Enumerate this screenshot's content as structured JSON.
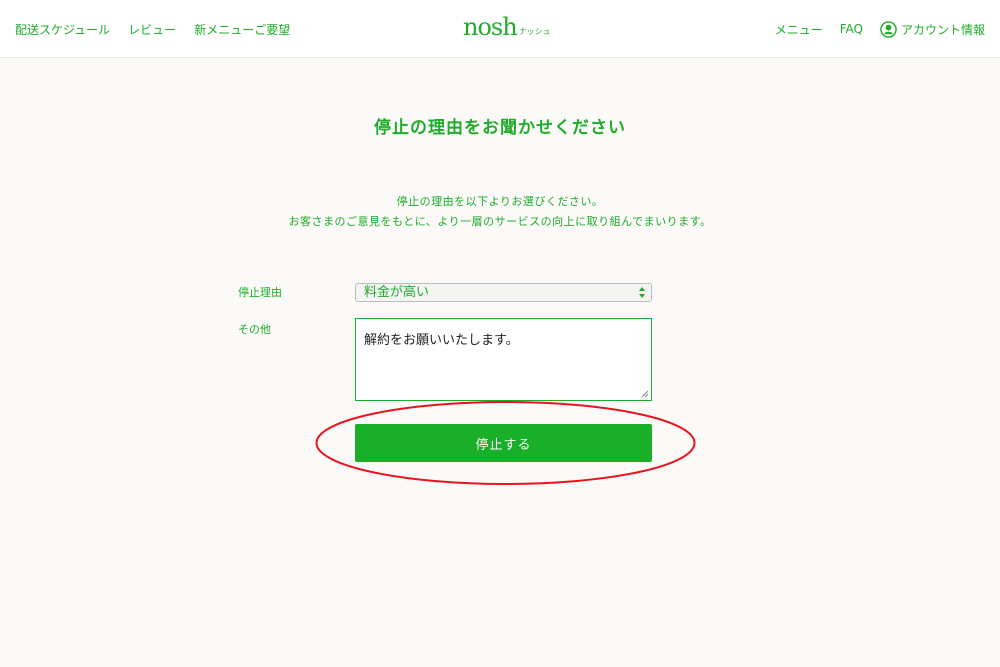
{
  "header": {
    "left_nav": [
      "配送スケジュール",
      "レビュー",
      "新メニューご要望"
    ],
    "logo_main": "nosh",
    "logo_sub": "ナッシュ",
    "right_nav": [
      "メニュー",
      "FAQ"
    ],
    "account_label": "アカウント情報"
  },
  "main": {
    "title": "停止の理由をお聞かせください",
    "description_line1": "停止の理由を以下よりお選びください。",
    "description_line2": "お客さまのご意見をもとに、より一層のサービスの向上に取り組んでまいります。",
    "reason_label": "停止理由",
    "reason_selected": "料金が高い",
    "other_label": "その他",
    "other_value": "解約をお願いいたします。",
    "submit_label": "停止する"
  },
  "colors": {
    "brand": "#1eac2a",
    "button": "#1aaf28",
    "annotation": "#e8141c",
    "background": "#fbfaf8"
  },
  "icons": [
    "account-icon",
    "select-arrows-icon",
    "resize-grip-icon"
  ]
}
